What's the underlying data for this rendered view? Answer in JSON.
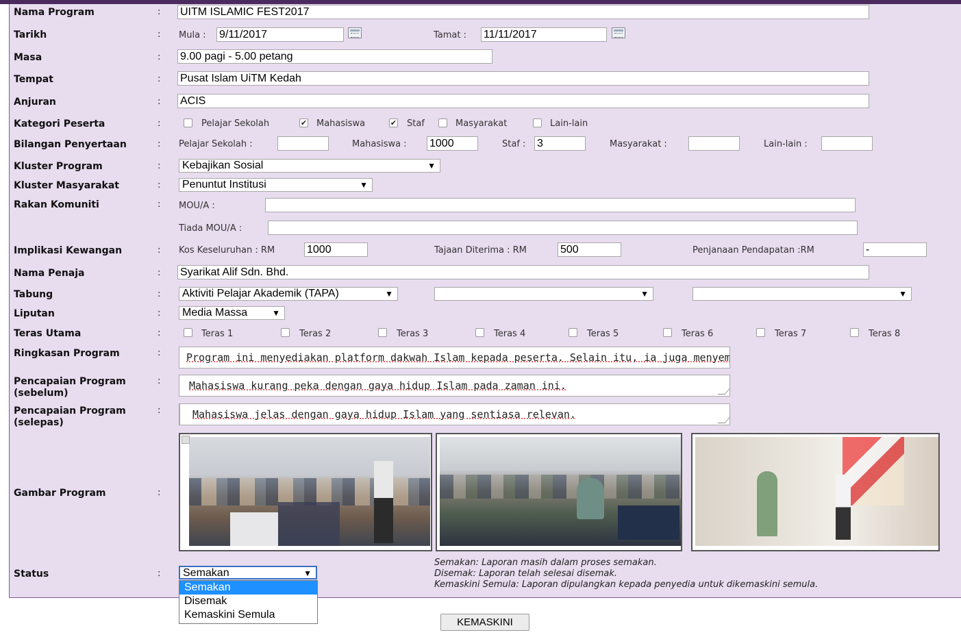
{
  "form": {
    "nama_program": {
      "label": "Nama Program",
      "value": "UITM ISLAMIC FEST2017"
    },
    "tarikh": {
      "label": "Tarikh",
      "mula_label": "Mula :",
      "mula_value": "9/11/2017",
      "tamat_label": "Tamat :",
      "tamat_value": "11/11/2017"
    },
    "masa": {
      "label": "Masa",
      "value": "9.00 pagi - 5.00 petang"
    },
    "tempat": {
      "label": "Tempat",
      "value": "Pusat Islam UiTM Kedah"
    },
    "anjuran": {
      "label": "Anjuran",
      "value": "ACIS"
    },
    "kategori": {
      "label": "Kategori Peserta",
      "options": [
        {
          "label": "Pelajar Sekolah",
          "checked": false
        },
        {
          "label": "Mahasiswa",
          "checked": true
        },
        {
          "label": "Staf",
          "checked": true
        },
        {
          "label": "Masyarakat",
          "checked": false
        },
        {
          "label": "Lain-lain",
          "checked": false
        }
      ]
    },
    "bilangan": {
      "label": "Bilangan Penyertaan",
      "items": [
        {
          "label": "Pelajar Sekolah :",
          "value": ""
        },
        {
          "label": "Mahasiswa :",
          "value": "1000"
        },
        {
          "label": "Staf :",
          "value": "3"
        },
        {
          "label": "Masyarakat :",
          "value": ""
        },
        {
          "label": "Lain-lain :",
          "value": ""
        }
      ]
    },
    "kluster_program": {
      "label": "Kluster Program",
      "value": "Kebajikan Sosial"
    },
    "kluster_masyarakat": {
      "label": "Kluster Masyarakat",
      "value": "Penuntut Institusi"
    },
    "rakan": {
      "label": "Rakan Komuniti",
      "mou_label": "MOU/A :",
      "mou_value": "",
      "tiada_label": "Tiada MOU/A :",
      "tiada_value": ""
    },
    "implikasi": {
      "label": "Implikasi Kewangan",
      "kos_label": "Kos Keseluruhan : RM",
      "kos_value": "1000",
      "tajaan_label": "Tajaan Diterima : RM",
      "tajaan_value": "500",
      "penjanaan_label": "Penjanaan Pendapatan :RM",
      "penjanaan_value": "-"
    },
    "nama_penaja": {
      "label": "Nama Penaja",
      "value": "Syarikat Alif Sdn. Bhd."
    },
    "tabung": {
      "label": "Tabung",
      "value1": "Aktiviti Pelajar Akademik (TAPA)",
      "value2": "",
      "value3": ""
    },
    "liputan": {
      "label": "Liputan",
      "value": "Media Massa"
    },
    "teras": {
      "label": "Teras Utama",
      "options": [
        "Teras 1",
        "Teras 2",
        "Teras 3",
        "Teras 4",
        "Teras 5",
        "Teras 6",
        "Teras 7",
        "Teras 8"
      ]
    },
    "ringkasan": {
      "label": "Ringkasan Program",
      "value": "Program ini menyediakan platform dakwah Islam kepada peserta. Selain itu, ia juga menyemarakkan"
    },
    "sebelum": {
      "label1": "Pencapaian Program",
      "label2": "(sebelum)",
      "value": "Mahasiswa kurang peka dengan gaya hidup Islam pada zaman ini."
    },
    "selepas": {
      "label1": "Pencapaian Program",
      "label2": "(selepas)",
      "value": "Mahasiswa jelas dengan gaya hidup Islam yang sentiasa relevan."
    },
    "gambar": {
      "label": "Gambar Program"
    },
    "status": {
      "label": "Status",
      "value": "Semakan",
      "options": [
        "Semakan",
        "Disemak",
        "Kemaskini Semula"
      ],
      "notes": [
        "Semakan: Laporan masih dalam proses semakan.",
        "Disemak: Laporan telah selesai disemak.",
        "Kemaskini Semula: Laporan dipulangkan kepada penyedia untuk dikemaskini semula."
      ]
    },
    "colon": ":",
    "arrow": "▼",
    "check": "✔"
  },
  "button": {
    "label": "KEMASKINI"
  },
  "colors": {
    "panel": "#e8dcef",
    "topbar": "#4b2a5e",
    "dropdown_highlight": "#1e90ff"
  }
}
